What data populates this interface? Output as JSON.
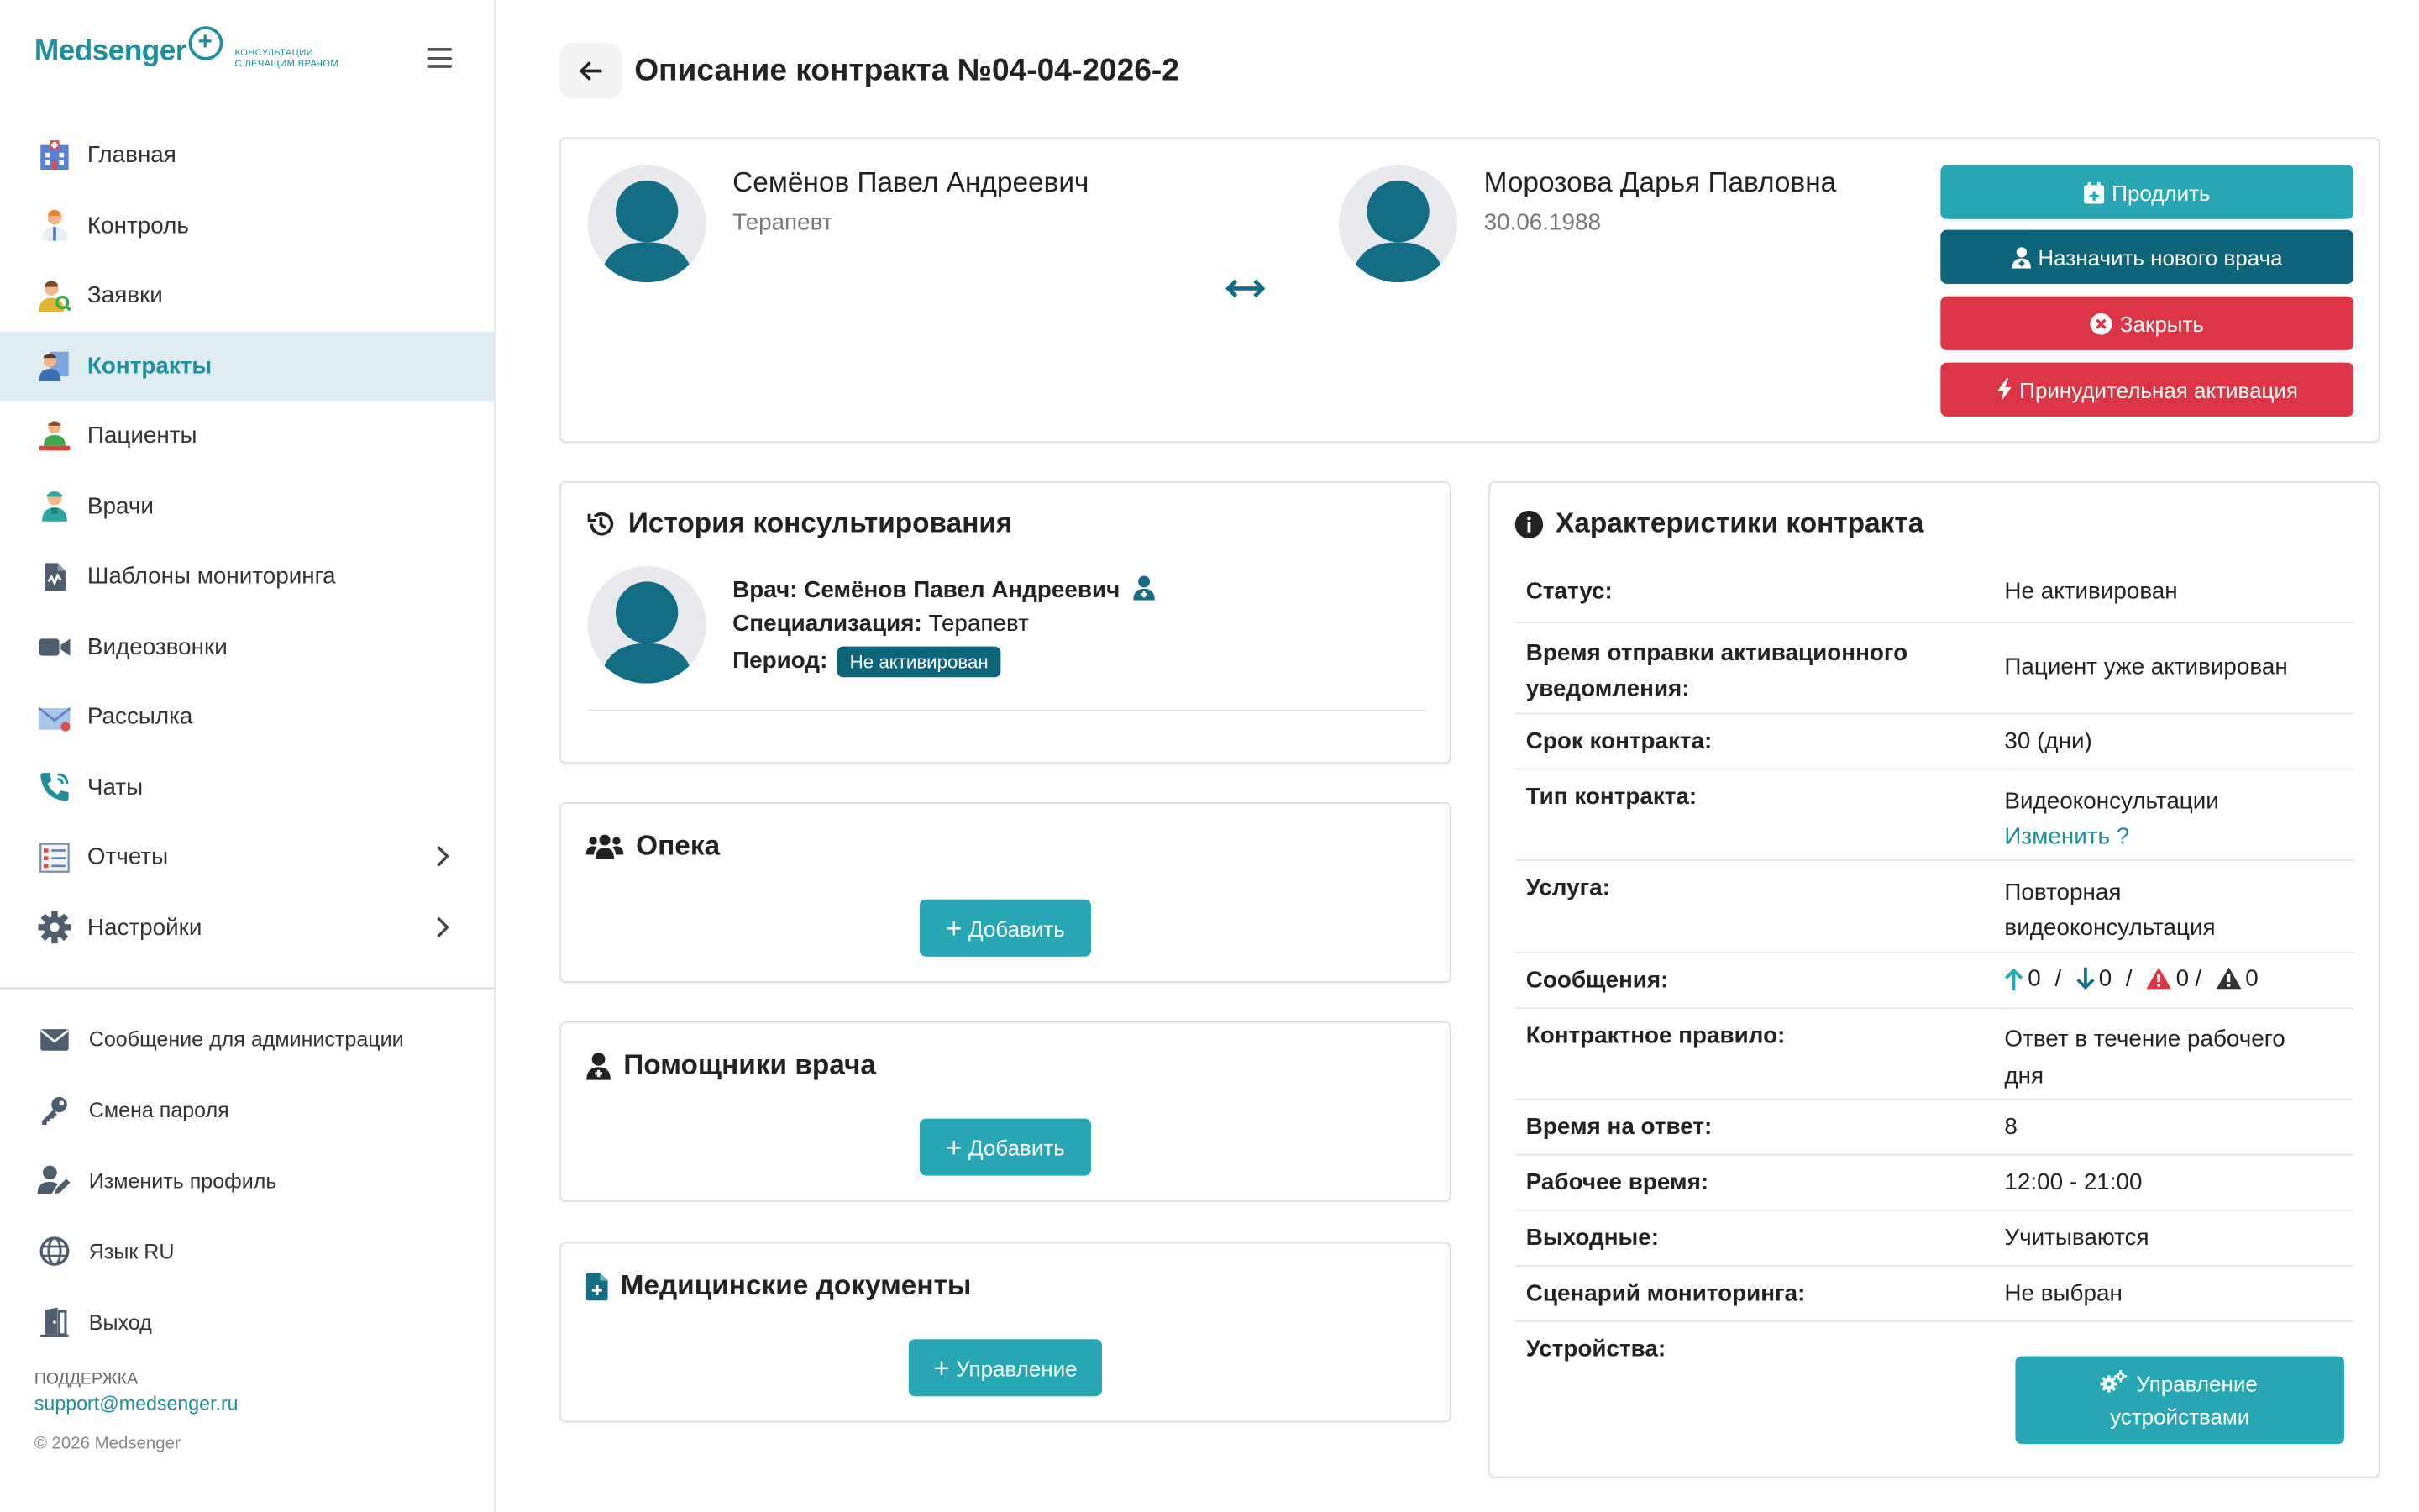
{
  "brand": {
    "name": "Medsenger",
    "tagline_1": "консультации",
    "tagline_2": "с лечащим врачом"
  },
  "nav": [
    {
      "label": "Главная",
      "icon": "hospital-icon"
    },
    {
      "label": "Контроль",
      "icon": "doctor-icon"
    },
    {
      "label": "Заявки",
      "icon": "user-search-icon"
    },
    {
      "label": "Контракты",
      "icon": "contract-icon",
      "active": true
    },
    {
      "label": "Пациенты",
      "icon": "patient-icon"
    },
    {
      "label": "Врачи",
      "icon": "medic-icon"
    },
    {
      "label": "Шаблоны мониторинга",
      "icon": "file-chart-icon"
    },
    {
      "label": "Видеозвонки",
      "icon": "video-icon"
    },
    {
      "label": "Рассылка",
      "icon": "mail-icon"
    },
    {
      "label": "Чаты",
      "icon": "phone-icon"
    },
    {
      "label": "Отчеты",
      "icon": "report-icon",
      "expandable": true
    },
    {
      "label": "Настройки",
      "icon": "gear-icon",
      "expandable": true
    }
  ],
  "bottom_nav": [
    {
      "label": "Сообщение для администрации",
      "icon": "envelope-icon"
    },
    {
      "label": "Смена пароля",
      "icon": "key-icon"
    },
    {
      "label": "Изменить профиль",
      "icon": "user-edit-icon"
    },
    {
      "label": "Язык RU",
      "icon": "globe-icon"
    },
    {
      "label": "Выход",
      "icon": "door-icon"
    }
  ],
  "support": {
    "label": "Поддержка",
    "email": "support@medsenger.ru"
  },
  "copyright": "© 2026 Medsenger",
  "page": {
    "title": "Описание контракта №04-04-2026-2"
  },
  "doctor": {
    "name": "Семёнов Павел Андреевич",
    "role": "Терапевт"
  },
  "patient": {
    "name": "Морозова Дарья Павловна",
    "birth": "30.06.1988"
  },
  "actions": {
    "extend": "Продлить",
    "assign": "Назначить нового врача",
    "close": "Закрыть",
    "force": "Принудительная активация"
  },
  "history": {
    "title": "История консультирования",
    "doctor_label": "Врач:",
    "doctor_value": "Семёнов Павел Андреевич",
    "spec_label": "Специализация:",
    "spec_value": "Терапевт",
    "period_label": "Период:",
    "period_badge": "Не активирован"
  },
  "guardianship": {
    "title": "Опека",
    "button": "Добавить"
  },
  "assistants": {
    "title": "Помощники врача",
    "button": "Добавить"
  },
  "documents": {
    "title": "Медицинские документы",
    "button": "Управление"
  },
  "props": {
    "title": "Характеристики контракта",
    "status_k": "Статус:",
    "status_v": "Не активирован",
    "notif_k": "Время отправки активационного уведомления:",
    "notif_v": "Пациент уже активирован",
    "term_k": "Срок контракта:",
    "term_v": "30 (дни)",
    "type_k": "Тип контракта:",
    "type_v": "Видеоконсультации",
    "type_link": "Изменить ?",
    "service_k": "Услуга:",
    "service_v": "Повторная видеоконсультация",
    "msgs_k": "Сообщения:",
    "msg_up": "0",
    "msg_down": "0",
    "msg_warn": "0",
    "msg_alert": "0",
    "msg_sep": "/",
    "rule_k": "Контрактное правило:",
    "rule_v": "Ответ в течение рабочего дня",
    "answer_k": "Время на ответ:",
    "answer_v": "8",
    "work_k": "Рабочее время:",
    "work_v": "12:00 - 21:00",
    "weekend_k": "Выходные:",
    "weekend_v": "Учитываются",
    "scenario_k": "Сценарий мониторинга:",
    "scenario_v": "Не выбран",
    "devices_k": "Устройства:",
    "devices_btn": "Управление устройствами"
  },
  "colors": {
    "accent": "#26a7b3",
    "dark": "#0e6478",
    "danger": "#dc3545",
    "active_bg": "#ddedf1"
  }
}
